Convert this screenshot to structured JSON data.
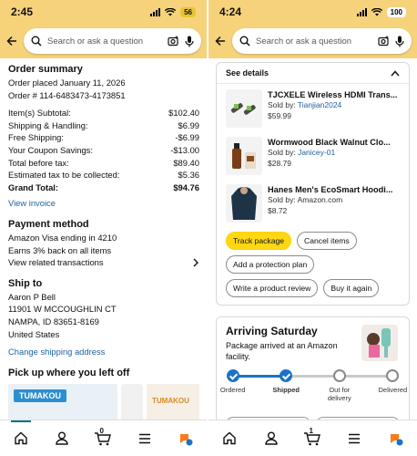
{
  "left": {
    "status": {
      "time": "2:45",
      "battery": "56"
    },
    "search": {
      "placeholder": "Search or ask a question"
    },
    "summary": {
      "title": "Order summary",
      "placed": "Order placed January 11, 2026",
      "order_number": "Order # 114-6483473-4173851",
      "lines": [
        {
          "label": "Item(s) Subtotal:",
          "value": "$102.40"
        },
        {
          "label": "Shipping & Handling:",
          "value": "$6.99"
        },
        {
          "label": "Free Shipping:",
          "value": "-$6.99"
        },
        {
          "label": "Your Coupon Savings:",
          "value": "-$13.00"
        },
        {
          "label": "Total before tax:",
          "value": "$89.40"
        },
        {
          "label": "Estimated tax to be collected:",
          "value": "$5.36"
        }
      ],
      "grand_total_label": "Grand Total:",
      "grand_total_value": "$94.76",
      "view_invoice": "View invoice"
    },
    "payment": {
      "title": "Payment method",
      "card": "Amazon Visa  ending in 4210",
      "rewards": "Earns 3% back on all items",
      "related": "View related transactions"
    },
    "ship": {
      "title": "Ship to",
      "lines": [
        "Aaron P Bell",
        "11901 W MCCOUGHLIN CT",
        "NAMPA, ID 83651-8169",
        "United States"
      ],
      "change": "Change shipping address"
    },
    "pickup": {
      "title": "Pick up where you left off",
      "brand": "TUMAKOU",
      "brand2": "TUMAKOU"
    },
    "cart_count": "0"
  },
  "right": {
    "status": {
      "time": "4:24",
      "battery": "100"
    },
    "search": {
      "placeholder": "Search or ask a question"
    },
    "details": "See details",
    "items": [
      {
        "title": "TJCXELE Wireless HDMI Trans...",
        "sold_label": "Sold by: ",
        "seller": "Tianjian2024",
        "price": "$59.99"
      },
      {
        "title": "Wormwood Black Walnut Clo...",
        "sold_label": "Sold by: ",
        "seller": "Janicey-01",
        "price": "$28.79"
      },
      {
        "title": "Hanes Men's EcoSmart Hoodi...",
        "sold_label": "Sold by: Amazon.com",
        "seller": "",
        "price": "$8.72"
      }
    ],
    "buttons": {
      "track": "Track package",
      "cancel": "Cancel items",
      "protection": "Add a protection plan",
      "review": "Write a product review",
      "buy_again": "Buy it again"
    },
    "arrival": {
      "title": "Arriving Saturday",
      "message": "Package arrived at an Amazon facility.",
      "steps": [
        "Ordered",
        "Shipped",
        "Out for delivery",
        "Delivered"
      ],
      "current_step": 1
    },
    "cart_count": "1"
  },
  "colors": {
    "header": "#f6d27b",
    "link": "#2162a1",
    "accent": "#1a73c4",
    "button_yellow": "#ffd814"
  }
}
